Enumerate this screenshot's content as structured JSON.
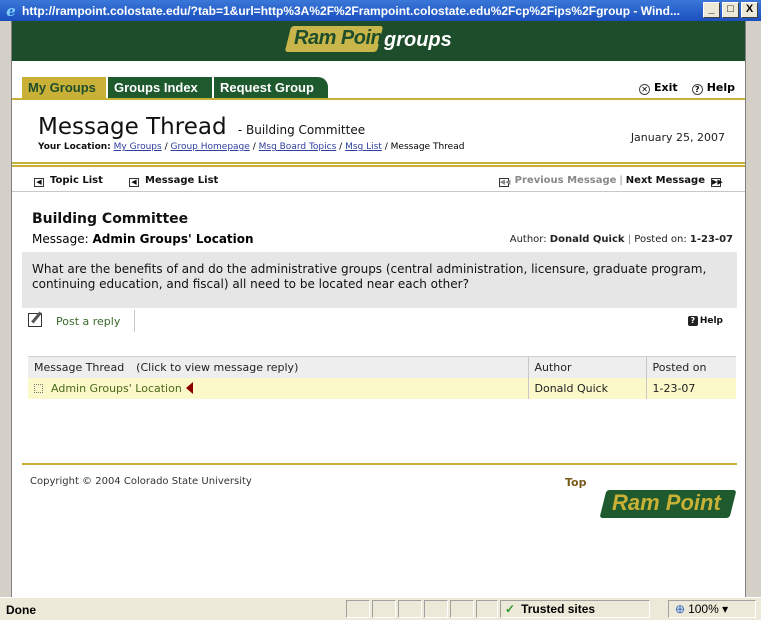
{
  "window": {
    "title": "http://rampoint.colostate.edu/?tab=1&url=http%3A%2F%2Frampoint.colostate.edu%2Fcp%2Fips%2Fgroup - Wind...",
    "minimize": "_",
    "maximize": "□",
    "close": "X"
  },
  "banner": {
    "logo": "Ram Point",
    "section": "groups"
  },
  "tabs": [
    {
      "label": "My Groups",
      "active": true
    },
    {
      "label": "Groups Index",
      "active": false
    },
    {
      "label": "Request Group",
      "active": false
    }
  ],
  "toplinks": {
    "exit": "Exit",
    "help": "Help"
  },
  "page": {
    "title": "Message Thread",
    "subtitle": "- Building Committee",
    "date": "January 25, 2007",
    "location_label": "Your Location:",
    "breadcrumb": [
      "My Groups",
      "Group Homepage",
      "Msg Board Topics",
      "Msg List"
    ],
    "breadcrumb_current": "Message Thread",
    "sep": "/"
  },
  "nav": {
    "topic_list": "Topic List",
    "message_list": "Message List",
    "previous": "Previous Message",
    "divider": "|",
    "next": "Next Message"
  },
  "message": {
    "group": "Building Committee",
    "label": "Message:",
    "subject": "Admin Groups' Location",
    "author_label": "Author:",
    "author": "Donald Quick",
    "posted_label": "Posted on:",
    "posted": "1-23-07",
    "body": "What are the benefits of and do the administrative groups (central administration, licensure, graduate program, continuing education, and fiscal) all need to be located near each other?"
  },
  "reply": {
    "label": "Post a reply",
    "help": "Help"
  },
  "thread": {
    "col_thread": "Message Thread",
    "col_hint": "(Click to view message reply)",
    "col_author": "Author",
    "col_posted": "Posted on",
    "rows": [
      {
        "subject": "Admin Groups' Location",
        "author": "Donald Quick",
        "posted": "1-23-07"
      }
    ]
  },
  "footer": {
    "copyright": "Copyright © 2004 Colorado State University",
    "top": "Top",
    "logo": "Ram Point"
  },
  "status": {
    "text": "Done",
    "zone": "Trusted sites",
    "zoom": "100%"
  }
}
